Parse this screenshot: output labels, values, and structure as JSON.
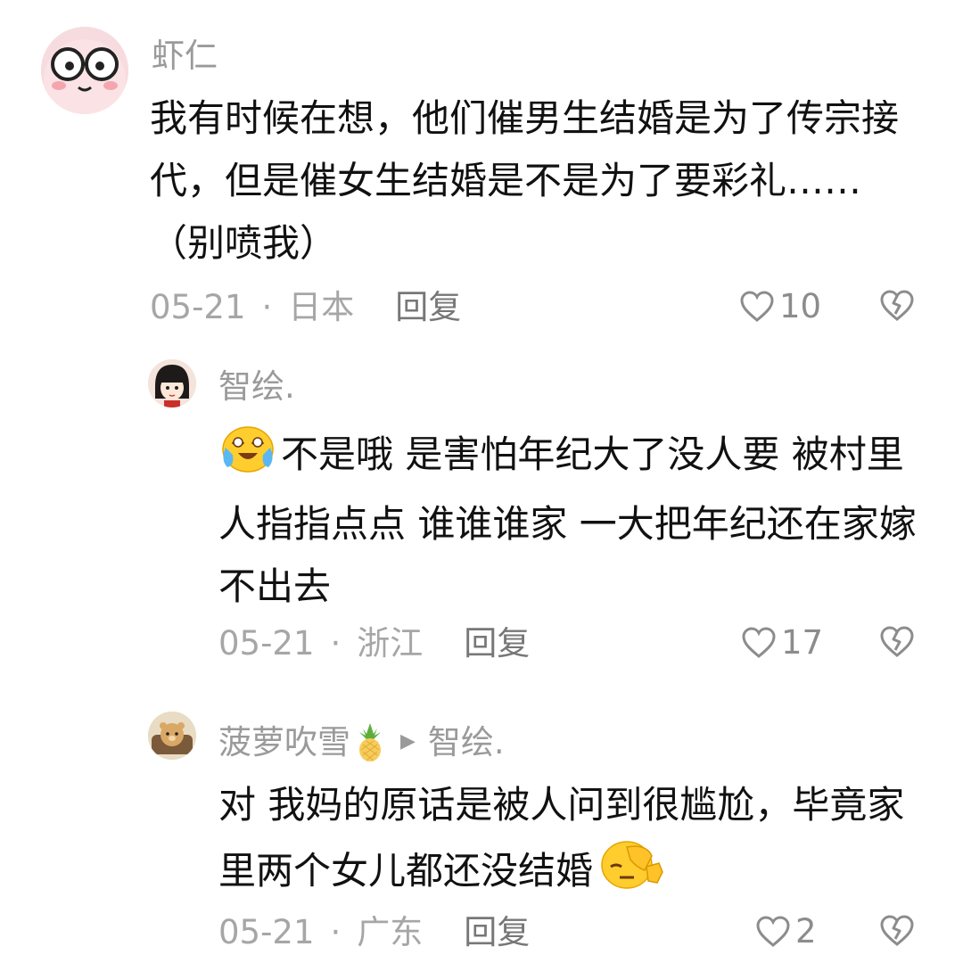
{
  "comments": [
    {
      "username": "虾仁",
      "avatar": "glasses-cartoon-avatar",
      "text": "我有时候在想，他们催男生结婚是为了传宗接代，但是催女生结婚是不是为了要彩礼……（别喷我）",
      "date": "05-21",
      "location": "日本",
      "reply_label": "回复",
      "likes": "10"
    },
    {
      "username": "智绘.",
      "avatar": "girl-cartoon-avatar",
      "emoji": "crying-laughing-emoji",
      "text": "不是哦 是害怕年纪大了没人要 被村里人指指点点 谁谁谁家 一大把年纪还在家嫁不出去",
      "date": "05-21",
      "location": "浙江",
      "reply_label": "回复",
      "likes": "17"
    },
    {
      "username": "菠萝吹雪",
      "username_emoji": "pineapple-emoji",
      "reply_to": "智绘.",
      "avatar": "bear-sofa-avatar",
      "text": "对 我妈的原话是被人问到很尴尬，毕竟家里两个女儿都还没结婚",
      "trailing_emoji": "facepalm-emoji",
      "date": "05-21",
      "location": "广东",
      "reply_label": "回复",
      "likes": "2"
    }
  ],
  "separator": "·",
  "colors": {
    "meta_text": "#a6a6a6",
    "username_text": "#9a9a9a",
    "body_text": "#111111"
  }
}
